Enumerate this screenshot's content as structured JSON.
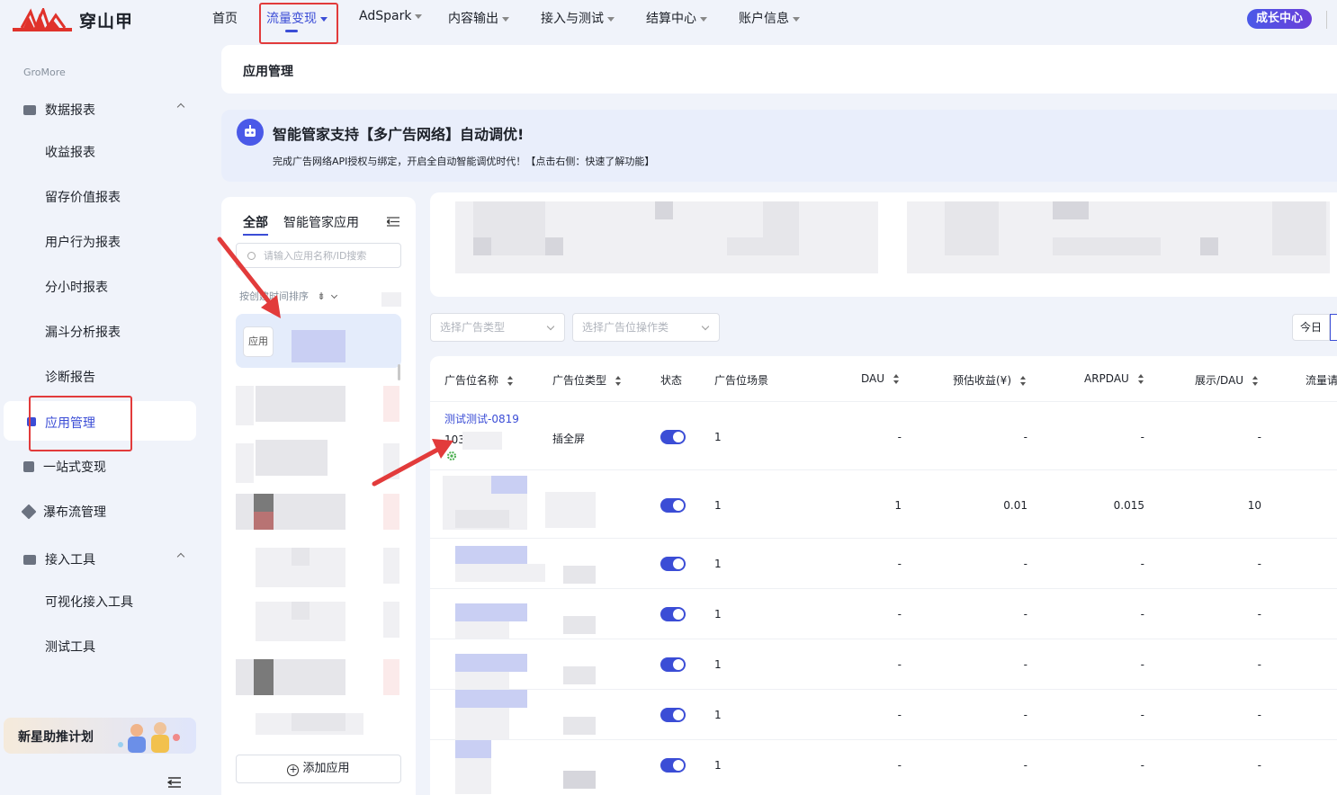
{
  "header": {
    "logo_text": "穿山甲",
    "nav": [
      {
        "label": "首页"
      },
      {
        "label": "流量变现"
      },
      {
        "label": "AdSpark"
      },
      {
        "label": "内容输出"
      },
      {
        "label": "接入与测试"
      },
      {
        "label": "结算中心"
      },
      {
        "label": "账户信息"
      }
    ],
    "growth_label": "成长中心"
  },
  "sidebar": {
    "section": "GroMore",
    "data_report": "数据报表",
    "reports": [
      "收益报表",
      "留存价值报表",
      "用户行为报表",
      "分小时报表",
      "漏斗分析报表",
      "诊断报告"
    ],
    "app_mgmt": "应用管理",
    "one_stop": "一站式变现",
    "waterfall": "瀑布流管理",
    "tools": "接入工具",
    "tool_items": [
      "可视化接入工具",
      "测试工具"
    ],
    "promo": "新星助推计划"
  },
  "breadcrumb": "应用管理",
  "banner": {
    "title": "智能管家支持【多广告网络】自动调优!",
    "desc": "完成广告网络API授权与绑定，开启全自动智能调优时代！【点击右侧：快速了解功能】"
  },
  "app_panel": {
    "tab_all": "全部",
    "tab_smart": "智能管家应用",
    "search_placeholder": "请输入应用名称/ID搜索",
    "sort_label": "按创建时间排序",
    "app_icon_text": "应用",
    "add_button": "添加应用"
  },
  "filters": {
    "ad_type_placeholder": "选择广告类型",
    "ad_op_placeholder": "选择广告位操作类",
    "today": "今日"
  },
  "table": {
    "headers": [
      "广告位名称",
      "广告位类型",
      "状态",
      "广告位场景",
      "DAU",
      "预估收益(¥)",
      "ARPDAU",
      "展示/DAU",
      "流量请"
    ],
    "rows": [
      {
        "name": "测试测试-0819",
        "id": "103",
        "type": "插全屏",
        "status_on": true,
        "scene": "1",
        "dau": "-",
        "revenue": "-",
        "arpdau": "-",
        "show_dau": "-"
      },
      {
        "name": "",
        "id": "",
        "type": "",
        "status_on": true,
        "scene": "1",
        "dau": "1",
        "revenue": "0.01",
        "arpdau": "0.015",
        "show_dau": "10"
      },
      {
        "name": "",
        "id": "",
        "type": "",
        "status_on": true,
        "scene": "1",
        "dau": "-",
        "revenue": "-",
        "arpdau": "-",
        "show_dau": "-"
      },
      {
        "name": "",
        "id": "",
        "type": "",
        "status_on": true,
        "scene": "1",
        "dau": "-",
        "revenue": "-",
        "arpdau": "-",
        "show_dau": "-"
      },
      {
        "name": "",
        "id": "",
        "type": "",
        "status_on": true,
        "scene": "1",
        "dau": "-",
        "revenue": "-",
        "arpdau": "-",
        "show_dau": "-"
      },
      {
        "name": "",
        "id": "",
        "type": "",
        "status_on": true,
        "scene": "1",
        "dau": "-",
        "revenue": "-",
        "arpdau": "-",
        "show_dau": "-"
      },
      {
        "name": "",
        "id": "",
        "type": "",
        "status_on": true,
        "scene": "1",
        "dau": "-",
        "revenue": "-",
        "arpdau": "-",
        "show_dau": "-"
      }
    ]
  },
  "colors": {
    "accent": "#3b4dd6",
    "annotation": "#e23b3b"
  }
}
